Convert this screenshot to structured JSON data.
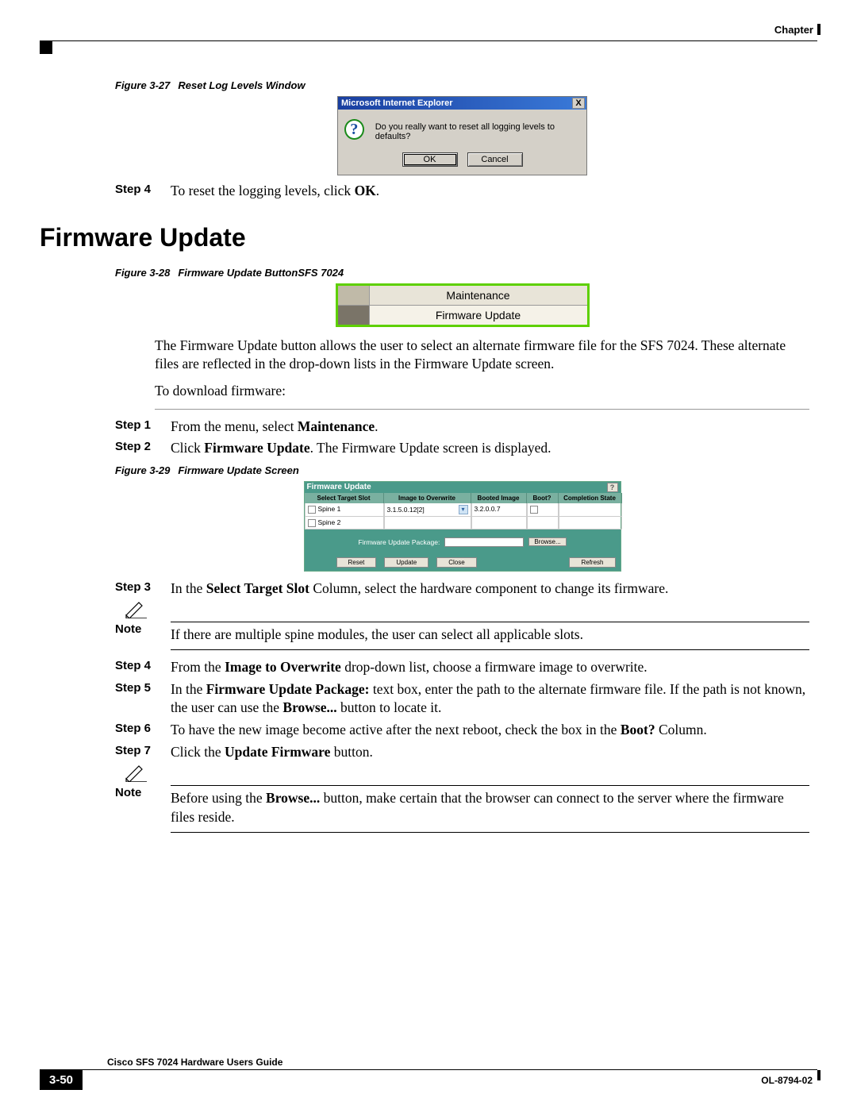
{
  "header": {
    "chapter": "Chapter"
  },
  "fig27": {
    "caption_num": "Figure 3-27",
    "caption_title": "Reset Log Levels Window",
    "title": "Microsoft Internet Explorer",
    "close": "X",
    "q": "?",
    "msg": "Do you really want to reset all logging levels to defaults?",
    "ok": "OK",
    "cancel": "Cancel"
  },
  "step4_top": {
    "label": "Step 4",
    "text_a": "To reset the logging levels, click ",
    "text_b": "OK",
    "text_c": "."
  },
  "h2": "Firmware Update",
  "fig28": {
    "caption_num": "Figure 3-28",
    "caption_title": "Firmware Update ButtonSFS 7024",
    "row1": "Maintenance",
    "row2": "Firmware Update"
  },
  "intro": "The Firmware Update button allows the user to select an alternate firmware file for the SFS 7024. These alternate files are reflected in the drop-down lists in the Firmware Update screen.",
  "dl_line": "To download firmware:",
  "step1": {
    "label": "Step 1",
    "a": "From the menu, select ",
    "b": "Maintenance",
    "c": "."
  },
  "step2": {
    "label": "Step 2",
    "a": "Click ",
    "b": "Firmware Update",
    "c": ". The Firmware Update screen is displayed."
  },
  "fig29": {
    "caption_num": "Figure 3-29",
    "caption_title": "Firmware Update Screen",
    "hdr": "Firmware Update",
    "help": "?",
    "cols": [
      "Select Target Slot",
      "Image to Overwrite",
      "Booted Image",
      "Boot?",
      "Completion State"
    ],
    "row1": {
      "slot": "Spine 1",
      "img": "3.1.5.0.12[2]",
      "boot": "3.2.0.0.7"
    },
    "row2": {
      "slot": "Spine 2"
    },
    "pkg_label": "Firmware Update Package:",
    "browse": "Browse...",
    "reset": "Reset",
    "update": "Update",
    "close": "Close",
    "refresh": "Refresh"
  },
  "step3": {
    "label": "Step 3",
    "a": "In the ",
    "b": "Select Target Slot",
    "c": " Column, select the hardware component to change its firmware."
  },
  "note1": {
    "label": "Note",
    "text": "If there are multiple spine modules, the user can select all applicable slots."
  },
  "step4": {
    "label": "Step 4",
    "a": "From the ",
    "b": "Image to Overwrite",
    "c": " drop-down list, choose a firmware image to overwrite."
  },
  "step5": {
    "label": "Step 5",
    "a": "In the ",
    "b": "Firmware Update Package:",
    "c": " text box, enter the path to the alternate firmware file. If the path is not known, the user can use the ",
    "d": "Browse...",
    "e": " button to locate it."
  },
  "step6": {
    "label": "Step 6",
    "a": "To have the new image become active after the next reboot, check the box in the ",
    "b": "Boot?",
    "c": " Column."
  },
  "step7": {
    "label": "Step 7",
    "a": "Click the ",
    "b": "Update Firmware",
    "c": " button."
  },
  "note2": {
    "label": "Note",
    "a": "Before using the ",
    "b": "Browse...",
    "c": " button, make certain that the browser can connect to the server where the firmware files reside."
  },
  "footer": {
    "title": "Cisco SFS 7024 Hardware Users Guide",
    "page": "3-50",
    "doc": "OL-8794-02"
  }
}
